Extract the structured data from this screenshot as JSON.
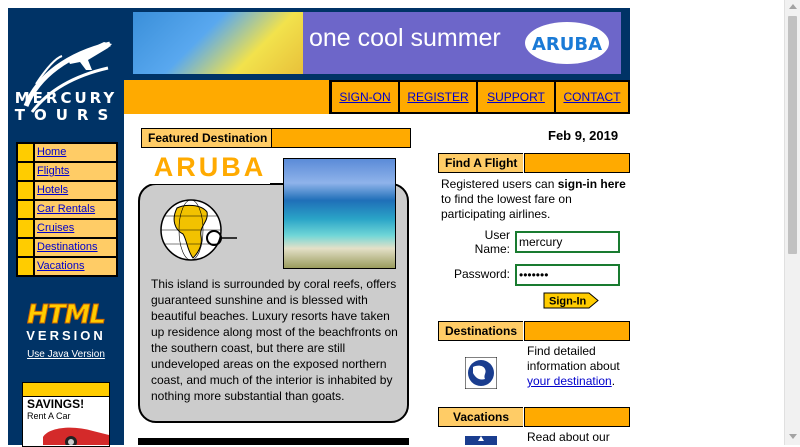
{
  "brand": {
    "line1": "MERCURY",
    "line2": "TOURS",
    "logo_icon": "airplane-swoosh-logo-icon"
  },
  "sidebar": {
    "items": [
      {
        "label": "Home"
      },
      {
        "label": "Flights"
      },
      {
        "label": "Hotels"
      },
      {
        "label": "Car Rentals"
      },
      {
        "label": "Cruises"
      },
      {
        "label": "Destinations"
      },
      {
        "label": "Vacations"
      }
    ],
    "html_version": {
      "big": "HTML",
      "small": "VERSION",
      "java_link": "Use Java Version"
    },
    "ad": {
      "savings": "SAVINGS!",
      "sub": "Rent A Car"
    }
  },
  "banner": {
    "text": "one cool summer",
    "badge": "ARUBA"
  },
  "menu": [
    {
      "label": "SIGN-ON"
    },
    {
      "label": "REGISTER"
    },
    {
      "label": "SUPPORT"
    },
    {
      "label": "CONTACT"
    }
  ],
  "featured": {
    "heading": "Featured Destination",
    "title": "ARUBA",
    "body": "This island is surrounded by coral reefs, offers guaranteed sunshine and is blessed with beautiful beaches. Luxury resorts have taken up residence along most of the beachfronts on the southern coast, but there are still undeveloped areas on the exposed northern coast, and much of the interior is inhabited by nothing more substantial than goats."
  },
  "date": "Feb 9, 2019",
  "find_flight": {
    "heading": "Find A Flight",
    "intro_pre": "Registered users can ",
    "intro_bold": "sign-in here",
    "intro_post": " to find the lowest fare on participating airlines.",
    "user_label": "User Name:",
    "user_value": "mercury",
    "password_label": "Password:",
    "password_value": "•••••••",
    "signin_button": "Sign-In"
  },
  "destinations": {
    "heading": "Destinations",
    "text_pre": "Find detailed information about ",
    "link": "your destination",
    "text_post": "."
  },
  "vacations": {
    "heading": "Vacations",
    "text": "Read about our"
  },
  "colors": {
    "navy": "#003366",
    "orange": "#ffaa00",
    "light_orange": "#ffcc66",
    "green": "#197b30",
    "link": "#0000cc"
  }
}
